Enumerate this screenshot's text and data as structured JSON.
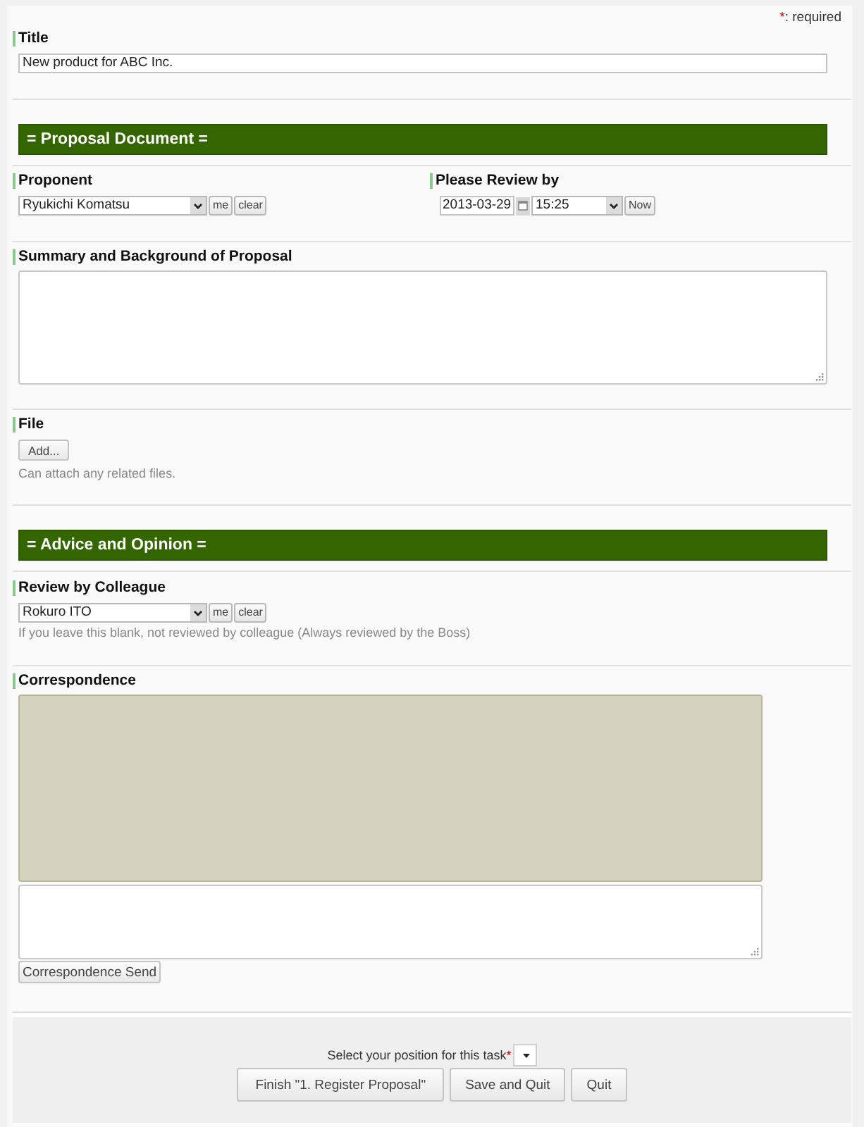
{
  "required_note": {
    "mark": "*",
    "text": ": required"
  },
  "fields": [
    {
      "kind": "text",
      "label": "Title",
      "value": "New product for ABC Inc."
    },
    {
      "kind": "heading",
      "text": "= Proposal Document ="
    },
    {
      "kind": "pair",
      "columns": [
        {
          "kind": "user",
          "label": "Proponent",
          "value": "Ryukichi Komatsu",
          "buttons": [
            "me",
            "clear"
          ]
        },
        {
          "kind": "datetime",
          "label": "Please Review by",
          "date": "2013-03-29",
          "time": "15:25",
          "button": "Now"
        }
      ]
    },
    {
      "kind": "textarea",
      "label": "Summary and Background of Proposal"
    },
    {
      "kind": "file",
      "label": "File",
      "button": "Add...",
      "hint": "Can attach any related files."
    },
    {
      "kind": "heading",
      "text": "= Advice and Opinion ="
    },
    {
      "kind": "user",
      "label": "Review by Colleague",
      "value": "Rokuro ITO",
      "buttons": [
        "me",
        "clear"
      ],
      "hint": "If you leave this blank, not reviewed by colleague (Always reviewed by the Boss)"
    },
    {
      "kind": "correspondence",
      "label": "Correspondence",
      "button": "Correspondence Send"
    }
  ],
  "footer": {
    "position_label": "Select your position for this task",
    "required_mark": "*",
    "buttons": [
      "Finish \"1. Register Proposal\"",
      "Save and Quit",
      "Quit"
    ]
  }
}
